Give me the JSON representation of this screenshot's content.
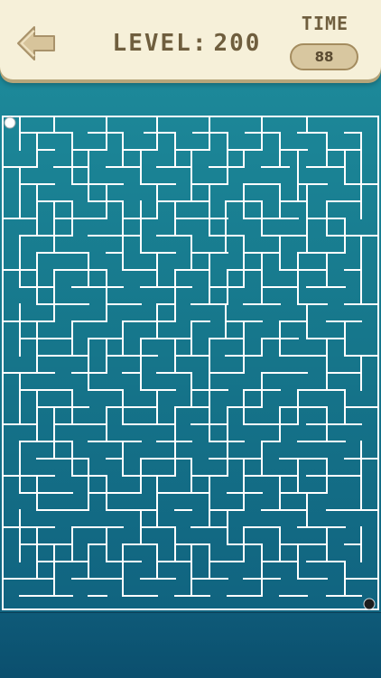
{
  "header": {
    "back_icon": "arrow-left-icon",
    "level_label": "LEVEL",
    "level_separator": ":",
    "level_value": "200",
    "time_label": "TIME",
    "time_value": "88"
  },
  "colors": {
    "header_bg": "#f6f0d9",
    "text": "#6f5e3e",
    "maze_bg_top": "#1f8e9e",
    "maze_bg_bottom": "#0f5f7d",
    "wall": "#ffffff"
  },
  "game": {
    "player_ball": "white-ball",
    "goal_ball": "black-ball"
  }
}
